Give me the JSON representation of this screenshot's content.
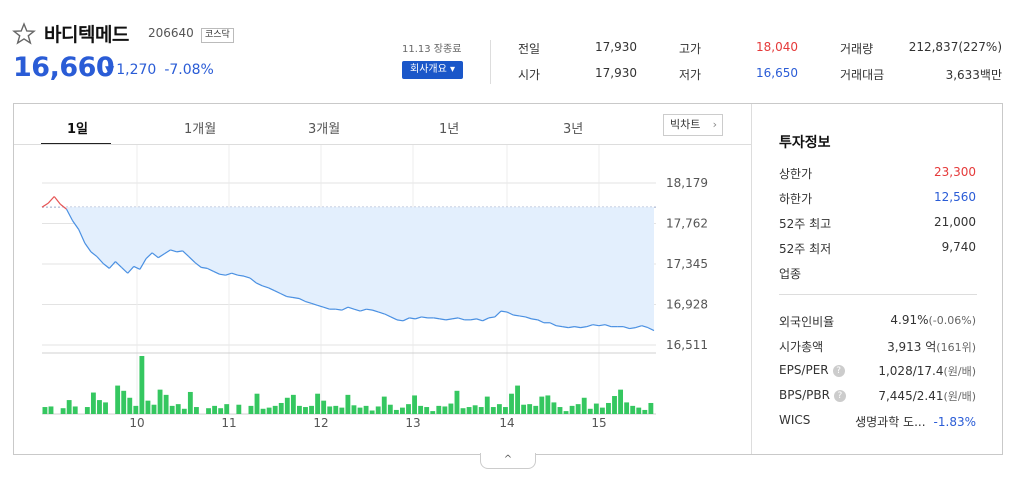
{
  "stock": {
    "name": "바디텍메드",
    "code": "206640",
    "market": "코스닥",
    "price": "16,660",
    "change_arrow": "▼",
    "change": "1,270",
    "change_pct": "-7.08%",
    "date_label": "11.13 장종료",
    "company_info_button": "회사개요 ▾"
  },
  "summary": [
    {
      "label": "전일",
      "value": "17,930",
      "color": "#333333"
    },
    {
      "label": "고가",
      "value": "18,040",
      "color": "#e53a3a"
    },
    {
      "label": "거래량",
      "value": "212,837(227%)",
      "color": "#333333"
    },
    {
      "label": "시가",
      "value": "17,930",
      "color": "#333333"
    },
    {
      "label": "저가",
      "value": "16,650",
      "color": "#2a5cd6"
    },
    {
      "label": "거래대금",
      "value": "3,633백만",
      "color": "#333333"
    }
  ],
  "tabs": [
    "1일",
    "1개월",
    "3개월",
    "1년",
    "3년"
  ],
  "big_chart_button": "빅차트",
  "chart_data": {
    "type": "line",
    "y_ticks": [
      "18,179",
      "17,762",
      "17,345",
      "16,928",
      "16,511"
    ],
    "ylim": [
      16511,
      18179
    ],
    "x_ticks": [
      "10",
      "11",
      "12",
      "13",
      "14",
      "15"
    ],
    "reference_price": 17930,
    "series": [
      {
        "values": [
          17930,
          17970,
          18040,
          17960,
          17910,
          17790,
          17700,
          17560,
          17470,
          17420,
          17350,
          17300,
          17370,
          17310,
          17250,
          17320,
          17290,
          17400,
          17460,
          17410,
          17450,
          17490,
          17470,
          17480,
          17420,
          17360,
          17310,
          17300,
          17270,
          17240,
          17230,
          17250,
          17230,
          17220,
          17200,
          17150,
          17120,
          17100,
          17070,
          17040,
          17010,
          17000,
          16990,
          16960,
          16940,
          16920,
          16900,
          16880,
          16880,
          16870,
          16900,
          16880,
          16860,
          16880,
          16870,
          16850,
          16830,
          16800,
          16770,
          16760,
          16790,
          16780,
          16800,
          16790,
          16790,
          16780,
          16770,
          16780,
          16790,
          16770,
          16770,
          16780,
          16760,
          16790,
          16800,
          16860,
          16850,
          16820,
          16810,
          16800,
          16780,
          16770,
          16740,
          16740,
          16710,
          16700,
          16690,
          16700,
          16690,
          16700,
          16720,
          16710,
          16720,
          16700,
          16700,
          16700,
          16680,
          16690,
          16710,
          16690,
          16660
        ]
      }
    ],
    "volume": [
      1,
      1,
      0,
      1,
      2,
      1,
      0,
      1,
      2,
      1,
      1,
      0,
      3,
      1,
      2,
      1,
      6,
      2,
      1,
      3,
      2,
      1,
      2,
      1,
      3,
      1,
      0,
      1,
      1,
      1,
      1,
      0,
      1,
      0,
      1,
      2,
      1,
      1,
      1,
      1,
      2,
      2,
      1,
      1,
      1,
      3,
      2,
      1,
      1,
      1,
      2,
      1,
      1,
      1,
      0,
      1,
      2,
      1,
      0,
      1,
      1,
      2,
      1,
      1,
      0,
      1,
      1,
      1,
      2,
      1,
      1,
      1,
      1,
      2,
      1,
      1,
      1,
      2,
      3,
      1,
      1,
      1,
      2,
      2,
      1,
      1,
      0,
      1,
      1,
      2,
      1,
      1,
      1,
      1,
      2,
      3,
      2,
      1,
      1,
      1,
      1
    ],
    "volume_heights": [
      12,
      13,
      0,
      10,
      24,
      13,
      0,
      12,
      37,
      24,
      20,
      0,
      49,
      40,
      28,
      14,
      100,
      23,
      16,
      42,
      33,
      14,
      17,
      9,
      38,
      12,
      0,
      10,
      14,
      10,
      17,
      0,
      16,
      0,
      14,
      35,
      9,
      11,
      14,
      19,
      28,
      33,
      14,
      12,
      14,
      35,
      23,
      13,
      14,
      11,
      33,
      15,
      11,
      14,
      6,
      13,
      30,
      16,
      7,
      11,
      17,
      32,
      14,
      12,
      5,
      14,
      13,
      18,
      40,
      10,
      12,
      15,
      12,
      30,
      12,
      17,
      12,
      35,
      49,
      16,
      17,
      14,
      30,
      32,
      20,
      12,
      5,
      14,
      17,
      28,
      9,
      18,
      11,
      19,
      31,
      42,
      20,
      14,
      11,
      7,
      19
    ]
  },
  "sidebar": {
    "title": "투자정보",
    "items": [
      {
        "label": "상한가",
        "value": "23,300",
        "color": "#e53a3a"
      },
      {
        "label": "하한가",
        "value": "12,560",
        "color": "#2a5cd6"
      },
      {
        "label": "52주 최고",
        "value": "21,000",
        "color": "#333333"
      },
      {
        "label": "52주 최저",
        "value": "9,740",
        "color": "#333333"
      },
      {
        "label": "업종",
        "value": "",
        "color": "#333333"
      }
    ],
    "items2": [
      {
        "label": "외국인비율",
        "value": "4.91%",
        "extra": "(-0.06%)"
      },
      {
        "label": "시가총액",
        "value": "3,913 억",
        "extra": "(161위)"
      },
      {
        "label": "EPS/PER",
        "value": "1,028/17.4",
        "extra": "(원/배)",
        "help": "?"
      },
      {
        "label": "BPS/PBR",
        "value": "7,445/2.41",
        "extra": "(원/배)",
        "help": "?"
      },
      {
        "label": "WICS",
        "value": "생명과학 도...",
        "extra": "-1.83%"
      }
    ]
  },
  "collapse_icon": "^"
}
